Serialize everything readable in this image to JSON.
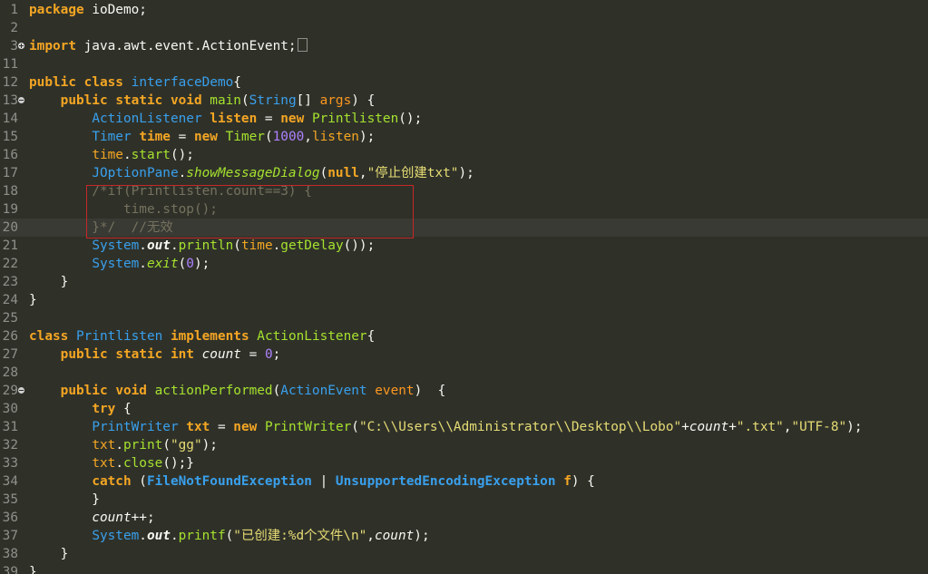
{
  "editor": {
    "language": "java",
    "colors": {
      "background": "#2f3129",
      "current_line": "#393a34",
      "gutter_text": "#8f908a",
      "keyword": "#f5a623",
      "class": "#39a0ed",
      "method": "#a6e22e",
      "string": "#e6db74",
      "number": "#ae81ff",
      "comment": "#75715e",
      "annotation_box": "#c62828"
    },
    "lines": [
      {
        "num": "1",
        "fold": "",
        "tokens": [
          [
            "kw",
            "package"
          ],
          [
            "plain",
            " ioDemo;"
          ]
        ]
      },
      {
        "num": "2",
        "fold": "",
        "tokens": []
      },
      {
        "num": "3",
        "fold": "plus",
        "tokens": [
          [
            "kw",
            "import"
          ],
          [
            "plain",
            " java.awt.event.ActionEvent;"
          ]
        ],
        "collapsed": true
      },
      {
        "num": "11",
        "fold": "",
        "tokens": []
      },
      {
        "num": "12",
        "fold": "",
        "tokens": [
          [
            "kw",
            "public"
          ],
          [
            "plain",
            " "
          ],
          [
            "kw",
            "class"
          ],
          [
            "plain",
            " "
          ],
          [
            "cls",
            "interfaceDemo"
          ],
          [
            "plain",
            "{"
          ]
        ]
      },
      {
        "num": "13",
        "fold": "minus",
        "tokens": [
          [
            "plain",
            "    "
          ],
          [
            "kw",
            "public"
          ],
          [
            "plain",
            " "
          ],
          [
            "kw",
            "static"
          ],
          [
            "plain",
            " "
          ],
          [
            "kw",
            "void"
          ],
          [
            "plain",
            " "
          ],
          [
            "fn",
            "main"
          ],
          [
            "plain",
            "("
          ],
          [
            "cls",
            "String"
          ],
          [
            "plain",
            "[] "
          ],
          [
            "param",
            "args"
          ],
          [
            "plain",
            ") {"
          ]
        ]
      },
      {
        "num": "14",
        "fold": "",
        "tokens": [
          [
            "plain",
            "        "
          ],
          [
            "cls",
            "ActionListener"
          ],
          [
            "plain",
            " "
          ],
          [
            "var-b",
            "listen"
          ],
          [
            "plain",
            " = "
          ],
          [
            "kw",
            "new"
          ],
          [
            "plain",
            " "
          ],
          [
            "type",
            "Printlisten"
          ],
          [
            "plain",
            "();"
          ]
        ]
      },
      {
        "num": "15",
        "fold": "",
        "tokens": [
          [
            "plain",
            "        "
          ],
          [
            "cls",
            "Timer"
          ],
          [
            "plain",
            " "
          ],
          [
            "var-b",
            "time"
          ],
          [
            "plain",
            " = "
          ],
          [
            "kw",
            "new"
          ],
          [
            "plain",
            " "
          ],
          [
            "type",
            "Timer"
          ],
          [
            "plain",
            "("
          ],
          [
            "num",
            "1000"
          ],
          [
            "plain",
            ","
          ],
          [
            "kw2",
            "listen"
          ],
          [
            "plain",
            ");"
          ]
        ]
      },
      {
        "num": "16",
        "fold": "",
        "tokens": [
          [
            "plain",
            "        "
          ],
          [
            "kw2",
            "time"
          ],
          [
            "plain",
            "."
          ],
          [
            "fn",
            "start"
          ],
          [
            "plain",
            "();"
          ]
        ]
      },
      {
        "num": "17",
        "fold": "",
        "tokens": [
          [
            "plain",
            "        "
          ],
          [
            "cls",
            "JOptionPane"
          ],
          [
            "plain",
            "."
          ],
          [
            "method-i",
            "showMessageDialog"
          ],
          [
            "plain",
            "("
          ],
          [
            "kw",
            "null"
          ],
          [
            "plain",
            ","
          ],
          [
            "str",
            "\"停止创建txt\""
          ],
          [
            "plain",
            ");"
          ]
        ]
      },
      {
        "num": "18",
        "fold": "",
        "tokens": [
          [
            "plain",
            "        "
          ],
          [
            "cm",
            "/*if(Printlisten.count==3) {"
          ]
        ]
      },
      {
        "num": "19",
        "fold": "",
        "tokens": [
          [
            "cm",
            "            time.stop();"
          ]
        ]
      },
      {
        "num": "20",
        "fold": "",
        "tokens": [
          [
            "cm",
            "        }*/  //无效"
          ]
        ],
        "current": true
      },
      {
        "num": "21",
        "fold": "",
        "tokens": [
          [
            "plain",
            "        "
          ],
          [
            "cls",
            "System"
          ],
          [
            "plain",
            "."
          ],
          [
            "static-i",
            "out"
          ],
          [
            "plain",
            "."
          ],
          [
            "fn",
            "println"
          ],
          [
            "plain",
            "("
          ],
          [
            "kw2",
            "time"
          ],
          [
            "plain",
            "."
          ],
          [
            "fn",
            "getDelay"
          ],
          [
            "plain",
            "());"
          ]
        ]
      },
      {
        "num": "22",
        "fold": "",
        "tokens": [
          [
            "plain",
            "        "
          ],
          [
            "cls",
            "System"
          ],
          [
            "plain",
            "."
          ],
          [
            "method-i",
            "exit"
          ],
          [
            "plain",
            "("
          ],
          [
            "num",
            "0"
          ],
          [
            "plain",
            ");"
          ]
        ]
      },
      {
        "num": "23",
        "fold": "",
        "tokens": [
          [
            "plain",
            "    }"
          ]
        ]
      },
      {
        "num": "24",
        "fold": "",
        "tokens": [
          [
            "plain",
            "}"
          ]
        ]
      },
      {
        "num": "25",
        "fold": "",
        "tokens": []
      },
      {
        "num": "26",
        "fold": "",
        "tokens": [
          [
            "kw",
            "class"
          ],
          [
            "plain",
            " "
          ],
          [
            "cls",
            "Printlisten"
          ],
          [
            "plain",
            " "
          ],
          [
            "kw",
            "implements"
          ],
          [
            "plain",
            " "
          ],
          [
            "type",
            "ActionListener"
          ],
          [
            "plain",
            "{"
          ]
        ]
      },
      {
        "num": "27",
        "fold": "",
        "tokens": [
          [
            "plain",
            "    "
          ],
          [
            "kw",
            "public"
          ],
          [
            "plain",
            " "
          ],
          [
            "kw",
            "static"
          ],
          [
            "plain",
            " "
          ],
          [
            "kw",
            "int"
          ],
          [
            "plain",
            " "
          ],
          [
            "field-i",
            "count"
          ],
          [
            "plain",
            " = "
          ],
          [
            "num",
            "0"
          ],
          [
            "plain",
            ";"
          ]
        ]
      },
      {
        "num": "28",
        "fold": "",
        "tokens": []
      },
      {
        "num": "29",
        "fold": "minus",
        "tokens": [
          [
            "plain",
            "    "
          ],
          [
            "kw",
            "public"
          ],
          [
            "plain",
            " "
          ],
          [
            "kw",
            "void"
          ],
          [
            "plain",
            " "
          ],
          [
            "fn",
            "actionPerformed"
          ],
          [
            "plain",
            "("
          ],
          [
            "cls",
            "ActionEvent"
          ],
          [
            "plain",
            " "
          ],
          [
            "param",
            "event"
          ],
          [
            "plain",
            ")  {"
          ]
        ]
      },
      {
        "num": "30",
        "fold": "",
        "tokens": [
          [
            "plain",
            "        "
          ],
          [
            "kw",
            "try"
          ],
          [
            "plain",
            " {"
          ]
        ]
      },
      {
        "num": "31",
        "fold": "",
        "tokens": [
          [
            "plain",
            "        "
          ],
          [
            "cls",
            "PrintWriter"
          ],
          [
            "plain",
            " "
          ],
          [
            "var-b",
            "txt"
          ],
          [
            "plain",
            " = "
          ],
          [
            "kw",
            "new"
          ],
          [
            "plain",
            " "
          ],
          [
            "type",
            "PrintWriter"
          ],
          [
            "plain",
            "("
          ],
          [
            "str",
            "\"C:\\\\Users\\\\Administrator\\\\Desktop\\\\Lobo\""
          ],
          [
            "plain",
            "+"
          ],
          [
            "field-i",
            "count"
          ],
          [
            "plain",
            "+"
          ],
          [
            "str",
            "\".txt\""
          ],
          [
            "plain",
            ","
          ],
          [
            "str",
            "\"UTF-8\""
          ],
          [
            "plain",
            ");"
          ]
        ]
      },
      {
        "num": "32",
        "fold": "",
        "tokens": [
          [
            "plain",
            "        "
          ],
          [
            "kw2",
            "txt"
          ],
          [
            "plain",
            "."
          ],
          [
            "fn",
            "print"
          ],
          [
            "plain",
            "("
          ],
          [
            "str",
            "\"gg\""
          ],
          [
            "plain",
            ");"
          ]
        ]
      },
      {
        "num": "33",
        "fold": "",
        "tokens": [
          [
            "plain",
            "        "
          ],
          [
            "kw2",
            "txt"
          ],
          [
            "plain",
            "."
          ],
          [
            "fn",
            "close"
          ],
          [
            "plain",
            "();}"
          ]
        ]
      },
      {
        "num": "34",
        "fold": "",
        "tokens": [
          [
            "plain",
            "        "
          ],
          [
            "kw",
            "catch"
          ],
          [
            "plain",
            " ("
          ],
          [
            "cls-b",
            "FileNotFoundException"
          ],
          [
            "plain",
            " | "
          ],
          [
            "cls-b",
            "UnsupportedEncodingException"
          ],
          [
            "plain",
            " "
          ],
          [
            "var-b",
            "f"
          ],
          [
            "plain",
            ") {"
          ]
        ]
      },
      {
        "num": "35",
        "fold": "",
        "tokens": [
          [
            "plain",
            "        }"
          ]
        ]
      },
      {
        "num": "36",
        "fold": "",
        "tokens": [
          [
            "plain",
            "        "
          ],
          [
            "field-i",
            "count"
          ],
          [
            "plain",
            "++;"
          ]
        ]
      },
      {
        "num": "37",
        "fold": "",
        "tokens": [
          [
            "plain",
            "        "
          ],
          [
            "cls",
            "System"
          ],
          [
            "plain",
            "."
          ],
          [
            "static-i",
            "out"
          ],
          [
            "plain",
            "."
          ],
          [
            "fn",
            "printf"
          ],
          [
            "plain",
            "("
          ],
          [
            "str",
            "\"已创建:%d个文件\\n\""
          ],
          [
            "plain",
            ","
          ],
          [
            "field-i",
            "count"
          ],
          [
            "plain",
            ");"
          ]
        ]
      },
      {
        "num": "38",
        "fold": "",
        "tokens": [
          [
            "plain",
            "    }"
          ]
        ]
      },
      {
        "num": "39",
        "fold": "",
        "tokens": [
          [
            "plain",
            "}"
          ]
        ]
      }
    ]
  }
}
